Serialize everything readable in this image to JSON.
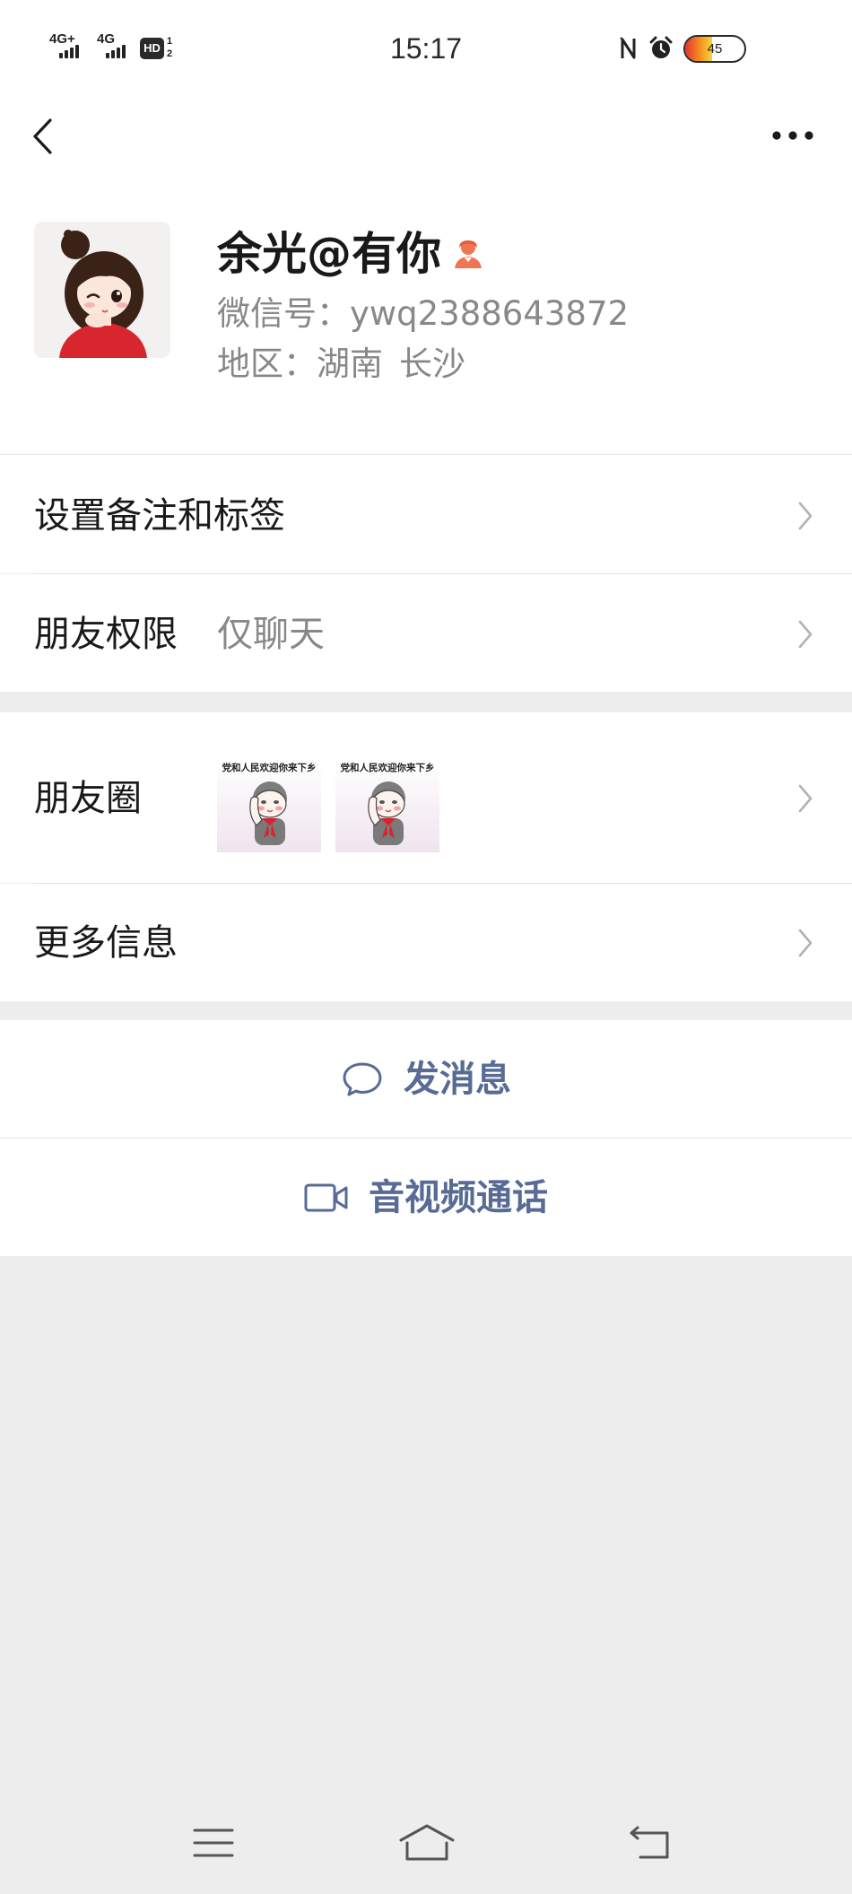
{
  "status_bar": {
    "time": "15:17",
    "network_1": "4G+",
    "network_2": "4G",
    "hd": "HD",
    "sim_top": "1",
    "sim_bottom": "2",
    "nfc_icon": "nfc-icon",
    "alarm_icon": "alarm-clock-icon",
    "battery_text": "45",
    "battery_level": 0.45
  },
  "nav": {
    "back_icon": "chevron-left-icon",
    "more_icon": "more-dots-icon"
  },
  "profile": {
    "name": "余光@有你",
    "gender_icon": "female-icon",
    "wechat_id_label": "微信号：",
    "wechat_id": "ywq2388643872",
    "region_label": "地区：",
    "province": "湖南",
    "city": "长沙"
  },
  "remark_row": {
    "label": "设置备注和标签"
  },
  "permission_row": {
    "label": "朋友权限",
    "value": "仅聊天"
  },
  "moments_row": {
    "label": "朋友圈",
    "thumbnails": [
      {
        "caption": "党和人民欢迎你来下乡"
      },
      {
        "caption": "党和人民欢迎你来下乡"
      }
    ]
  },
  "more_info_row": {
    "label": "更多信息"
  },
  "actions": {
    "message": {
      "label": "发消息",
      "icon": "chat-bubble-icon"
    },
    "call": {
      "label": "音视频通话",
      "icon": "video-camera-icon"
    }
  },
  "system_nav": {
    "menu_icon": "menu-icon",
    "home_icon": "home-icon",
    "back_icon": "return-icon"
  },
  "colors": {
    "link": "#576b95",
    "page_background": "#ededed",
    "card_background": "#ffffff",
    "secondary_text": "#888888",
    "gender_female": "#f07552"
  }
}
